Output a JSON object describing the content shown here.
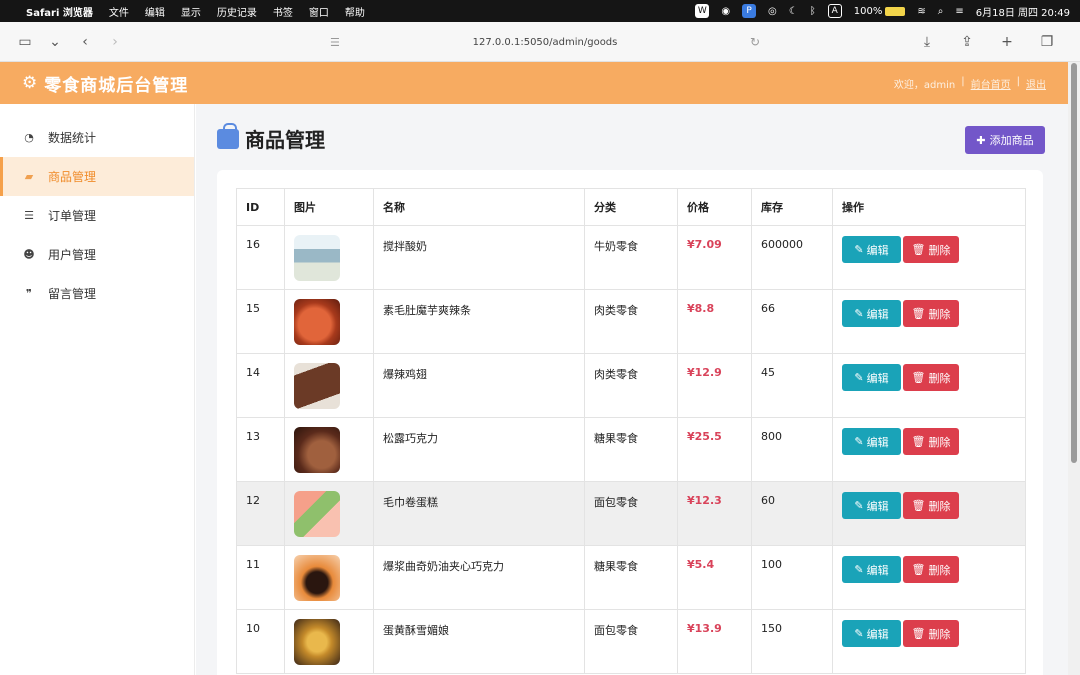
{
  "menubar": {
    "items": [
      "Safari 浏览器",
      "文件",
      "编辑",
      "显示",
      "历史记录",
      "书签",
      "窗口",
      "帮助"
    ],
    "battery": "100%",
    "datetime": "6月18日 周四  20:49"
  },
  "browser": {
    "url": "127.0.0.1:5050/admin/goods"
  },
  "header": {
    "title": "零食商城后台管理",
    "welcome": "欢迎，admin",
    "home_link": "前台首页",
    "logout_link": "退出"
  },
  "sidebar": {
    "items": [
      {
        "label": "数据统计",
        "icon": "dashboard-icon"
      },
      {
        "label": "商品管理",
        "icon": "shopping-bag-icon",
        "active": true
      },
      {
        "label": "订单管理",
        "icon": "list-icon"
      },
      {
        "label": "用户管理",
        "icon": "users-icon"
      },
      {
        "label": "留言管理",
        "icon": "comments-icon"
      }
    ]
  },
  "page": {
    "title": "商品管理",
    "add_button": "添加商品"
  },
  "table": {
    "headers": [
      "ID",
      "图片",
      "名称",
      "分类",
      "价格",
      "库存",
      "操作"
    ],
    "edit_label": "编辑",
    "delete_label": "删除",
    "rows": [
      {
        "id": "16",
        "name": "搅拌酸奶",
        "category": "牛奶零食",
        "price": "¥7.09",
        "stock": "600000"
      },
      {
        "id": "15",
        "name": "素毛肚魔芋爽辣条",
        "category": "肉类零食",
        "price": "¥8.8",
        "stock": "66"
      },
      {
        "id": "14",
        "name": "爆辣鸡翅",
        "category": "肉类零食",
        "price": "¥12.9",
        "stock": "45"
      },
      {
        "id": "13",
        "name": "松露巧克力",
        "category": "糖果零食",
        "price": "¥25.5",
        "stock": "800"
      },
      {
        "id": "12",
        "name": "毛巾卷蛋糕",
        "category": "面包零食",
        "price": "¥12.3",
        "stock": "60"
      },
      {
        "id": "11",
        "name": "爆浆曲奇奶油夹心巧克力",
        "category": "糖果零食",
        "price": "¥5.4",
        "stock": "100"
      },
      {
        "id": "10",
        "name": "蛋黄酥雪媚娘",
        "category": "面包零食",
        "price": "¥13.9",
        "stock": "150"
      }
    ]
  },
  "colors": {
    "header_bg": "#f7ab61",
    "add_button": "#7357c9",
    "edit_button": "#1aa3b8",
    "delete_button": "#dc3e4c",
    "price": "#d9435a"
  }
}
